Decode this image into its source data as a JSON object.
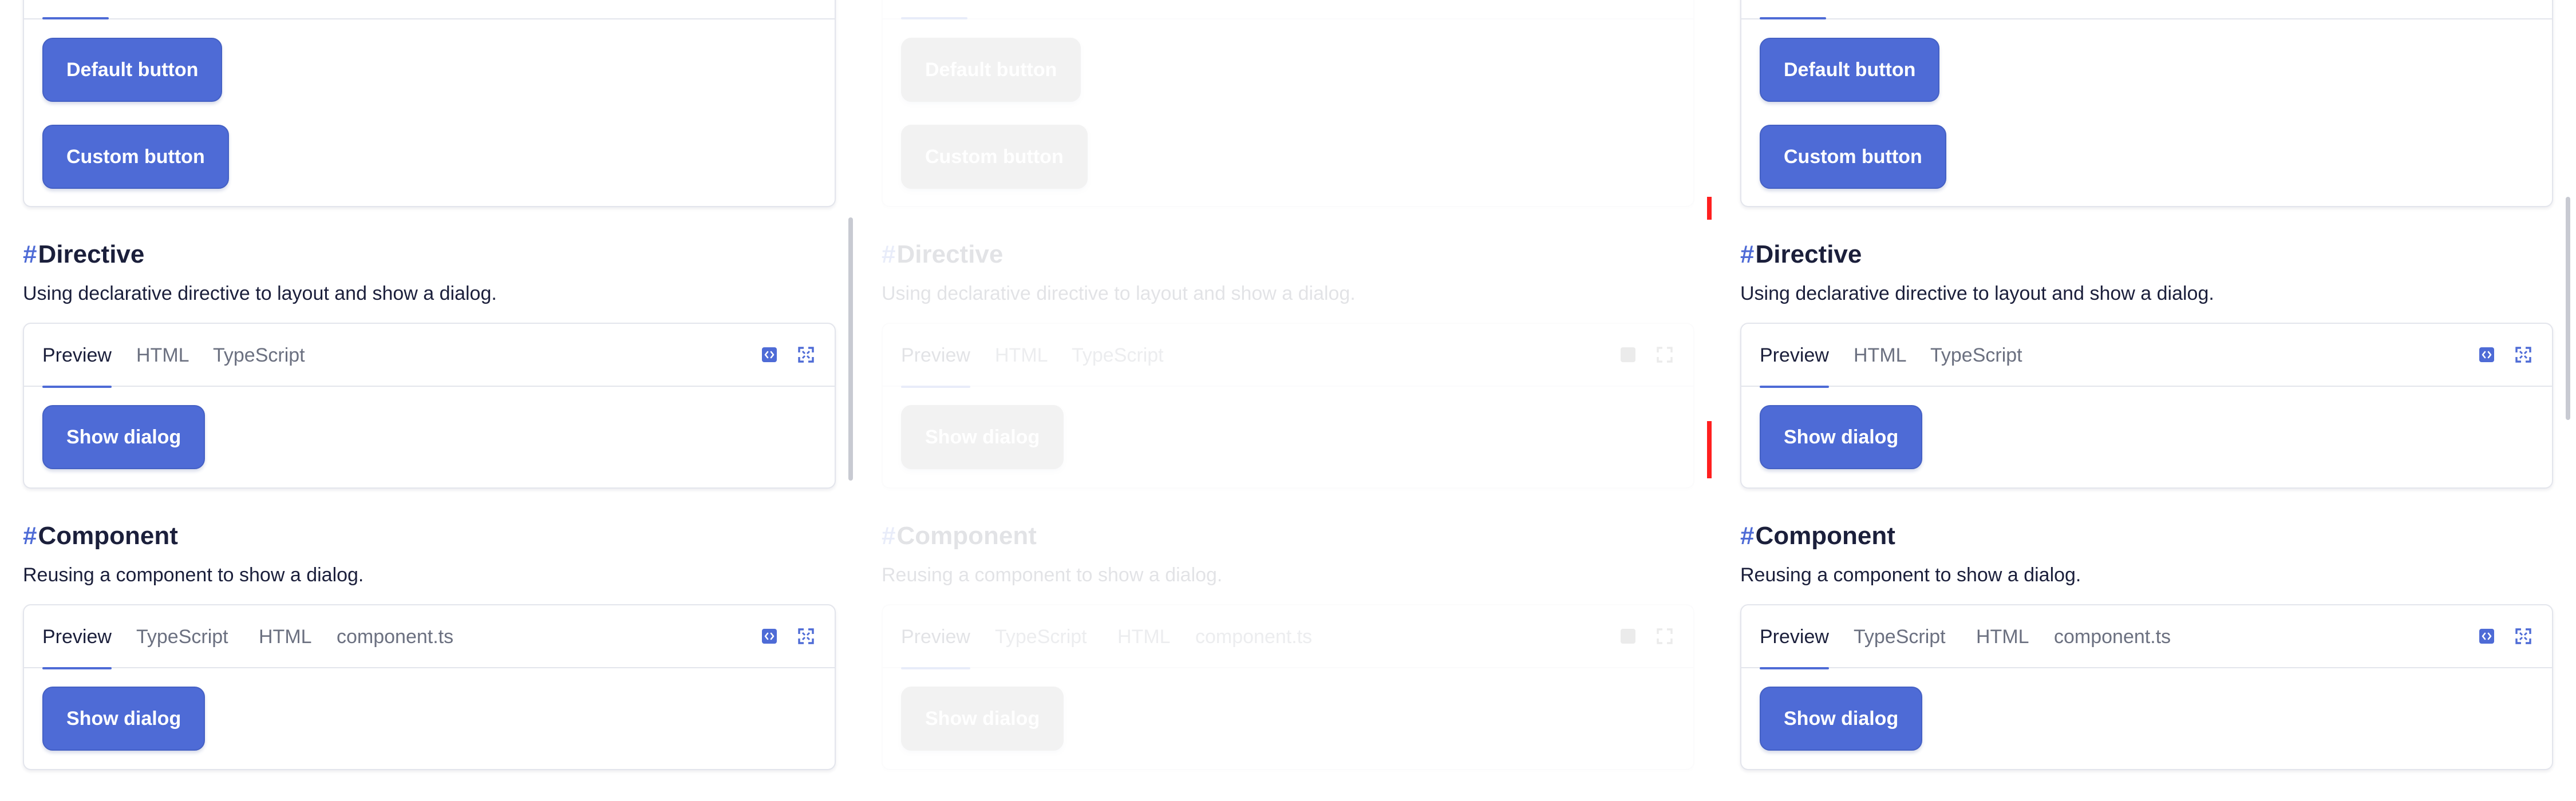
{
  "top_card": {
    "buttons": [
      {
        "label": "Default button"
      },
      {
        "label": "Custom button"
      }
    ]
  },
  "sections": [
    {
      "hash": "#",
      "title": "Directive",
      "description": "Using declarative directive to layout and show a dialog.",
      "tabs": [
        "Preview",
        "HTML",
        "TypeScript"
      ],
      "button_label": "Show dialog"
    },
    {
      "hash": "#",
      "title": "Component",
      "description": "Reusing a component to show a dialog.",
      "tabs": [
        "Preview",
        "TypeScript",
        "HTML",
        "component.ts"
      ],
      "button_label": "Show dialog"
    }
  ],
  "icons": {
    "code_toggle": "code-icon",
    "fullscreen": "fullscreen-icon"
  },
  "colors": {
    "accent": "#4e6bd6",
    "border": "#e3e5ec",
    "text": "#1b1f3b",
    "muted_tab": "#6b7080",
    "error_marker": "#ff1f1f"
  }
}
